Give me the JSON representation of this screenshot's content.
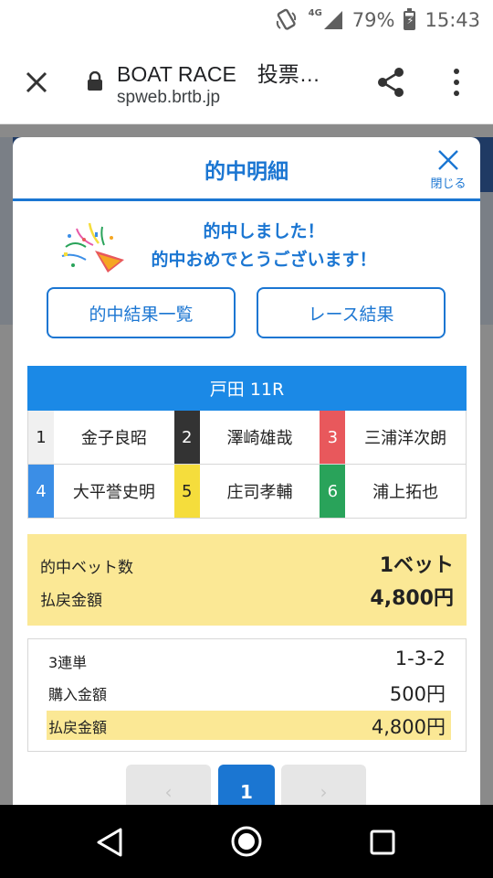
{
  "status_bar": {
    "network": "4G",
    "battery": "79%",
    "time": "15:43",
    "icons": [
      "vibrate-icon",
      "signal-icon",
      "battery-charging-icon"
    ]
  },
  "browser": {
    "title": "BOAT RACE　投票…",
    "url": "spweb.brtb.jp"
  },
  "modal": {
    "title": "的中明細",
    "close_label": "閉じる",
    "congrats_line1": "的中しました！",
    "congrats_line2": "的中おめでとうございます！",
    "buttons": [
      "的中結果一覧",
      "レース結果"
    ],
    "race": "戸田 11R",
    "racers": [
      {
        "num": "1",
        "name": "金子良昭",
        "bg": "#f0f0f0",
        "fg": "#222222"
      },
      {
        "num": "2",
        "name": "澤崎雄哉",
        "bg": "#333333",
        "fg": "#ffffff"
      },
      {
        "num": "3",
        "name": "三浦洋次朗",
        "bg": "#e8585c",
        "fg": "#ffffff"
      },
      {
        "num": "4",
        "name": "大平誉史明",
        "bg": "#3b8ee6",
        "fg": "#ffffff"
      },
      {
        "num": "5",
        "name": "庄司孝輔",
        "bg": "#f5dd3c",
        "fg": "#222222"
      },
      {
        "num": "6",
        "name": "浦上拓也",
        "bg": "#29a35a",
        "fg": "#ffffff"
      }
    ],
    "summary": {
      "hit_bets_label": "的中ベット数",
      "hit_bets_value": "1ベット",
      "payout_label": "払戻金額",
      "payout_value": "4,800円"
    },
    "detail": {
      "bet_type": "3連単",
      "combination": "1-3-2",
      "purchase_label": "購入金額",
      "purchase_value": "500円",
      "payout_label": "払戻金額",
      "payout_value": "4,800円"
    },
    "pager": {
      "prev": "‹",
      "current": "1",
      "next": "›"
    }
  },
  "colors": {
    "accent": "#1b76d2",
    "race_header": "#1b89e6",
    "highlight": "#fbe895"
  }
}
